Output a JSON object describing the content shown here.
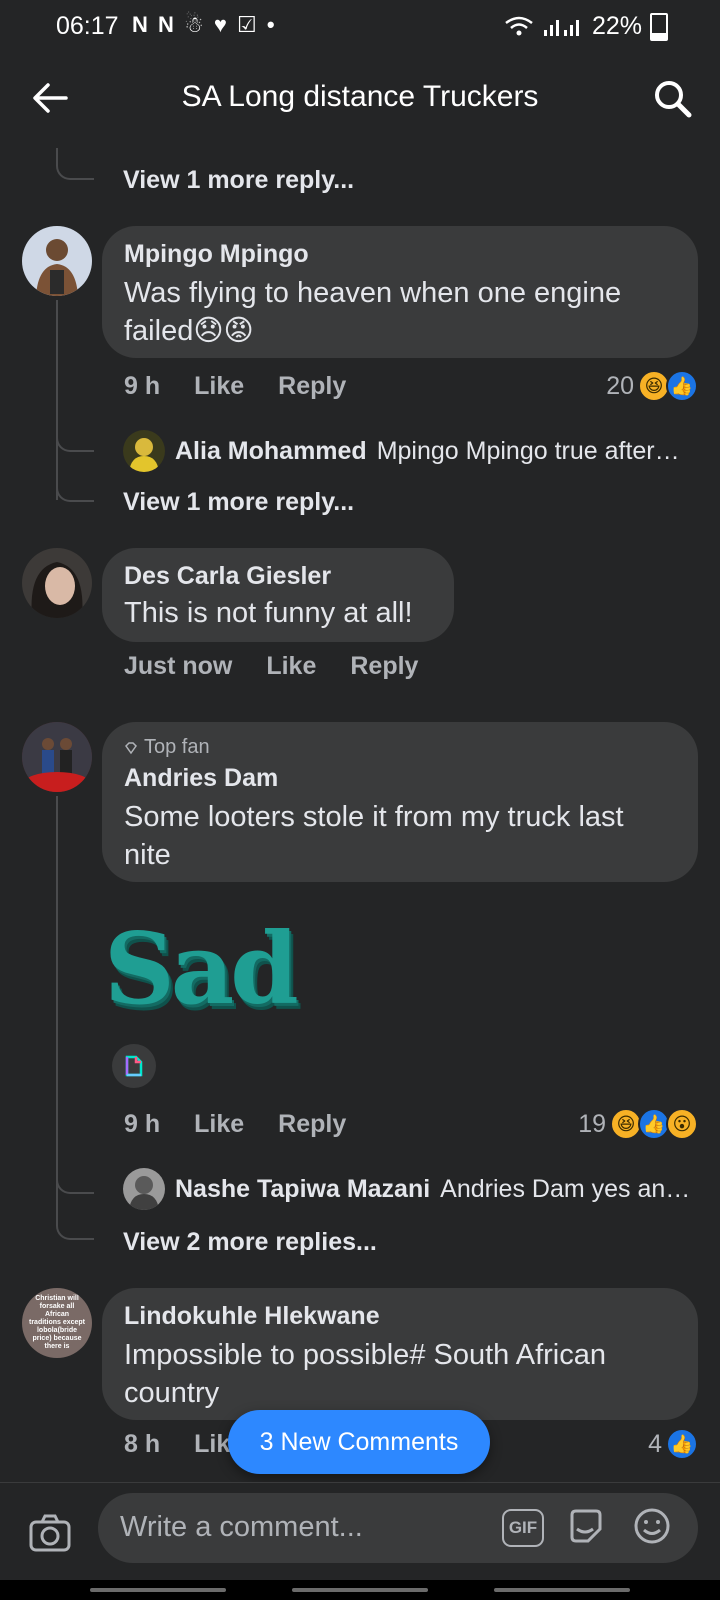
{
  "status": {
    "time": "06:17",
    "icons": "N N ☃ ♥ ☑ •",
    "battery": "22%"
  },
  "header": {
    "title": "SA Long distance Truckers"
  },
  "top_view_more": "View 1 more reply...",
  "comments": [
    {
      "author": "Mpingo Mpingo",
      "text": "Was flying to heaven when one engine failed😞😡",
      "time": "9 h",
      "like": "Like",
      "reply": "Reply",
      "reaction_count": "20"
    },
    {
      "author": "Des Carla Giesler",
      "text": "This is not funny at all!",
      "time": "Just now",
      "like": "Like",
      "reply": "Reply"
    },
    {
      "badge": "Top fan",
      "author": "Andries Dam",
      "text": "Some looters stole it from my truck last nite",
      "sticker_text": "Sad",
      "time": "9 h",
      "like": "Like",
      "reply": "Reply",
      "reaction_count": "19"
    },
    {
      "author": "Lindokuhle Hlekwane",
      "text": "Impossible to possible# South African country",
      "time": "8 h",
      "like": "Lik",
      "reaction_count": "4"
    }
  ],
  "replies": [
    {
      "author": "Alia Mohammed",
      "text": "Mpingo Mpingo true after…",
      "view_more": "View 1 more reply..."
    },
    {
      "author": "Nashe Tapiwa Mazani",
      "text": "Andries Dam yes an…",
      "view_more": "View 2 more replies..."
    }
  ],
  "avatar_lindokuhle_text": "Christian will forsake all African traditions except lobola(bride price) because there is",
  "new_comments": "3 New Comments",
  "composer": {
    "placeholder": "Write a comment...",
    "gif": "GIF"
  },
  "colors": {
    "background": "#242526",
    "bubble": "#3a3b3c",
    "accent": "#2d88ff",
    "sticker": "#1f9e93"
  }
}
